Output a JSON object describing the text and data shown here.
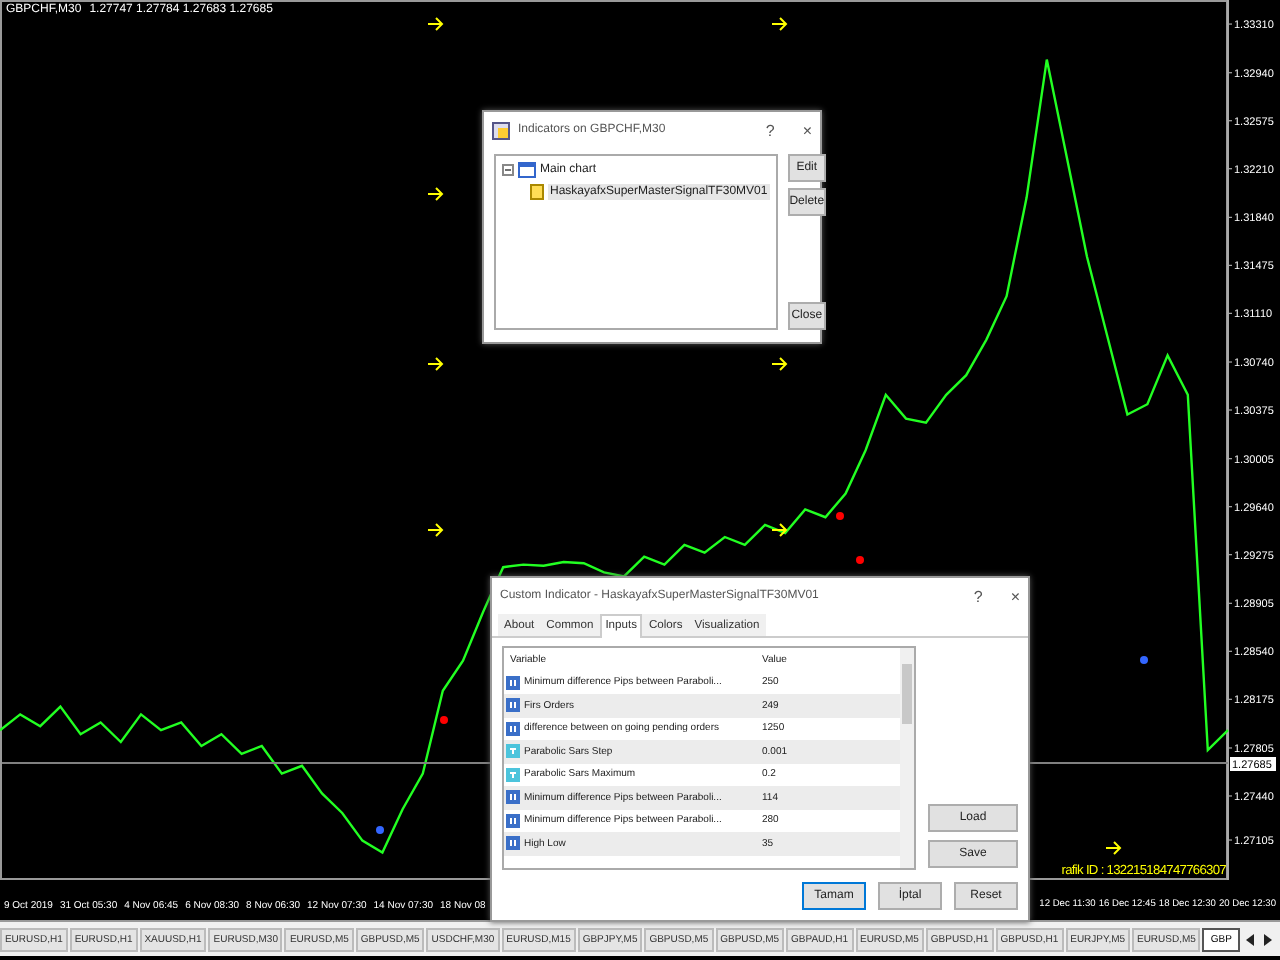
{
  "chart": {
    "chart_data": {
      "type": "line",
      "ylim": [
        1.26801,
        1.33493
      ],
      "yticks": [
        {
          "value": 1.3331,
          "label": "1.33310"
        },
        {
          "value": 1.3294,
          "label": "1.32940"
        },
        {
          "value": 1.32575,
          "label": "1.32575"
        },
        {
          "value": 1.3221,
          "label": "1.32210"
        },
        {
          "value": 1.3184,
          "label": "1.31840"
        },
        {
          "value": 1.31475,
          "label": "1.31475"
        },
        {
          "value": 1.3111,
          "label": "1.31110"
        },
        {
          "value": 1.3074,
          "label": "1.30740"
        },
        {
          "value": 1.30375,
          "label": "1.30375"
        },
        {
          "value": 1.30005,
          "label": "1.30005"
        },
        {
          "value": 1.2964,
          "label": "1.29640"
        },
        {
          "value": 1.29275,
          "label": "1.29275"
        },
        {
          "value": 1.28905,
          "label": "1.28905"
        },
        {
          "value": 1.2854,
          "label": "1.28540"
        },
        {
          "value": 1.28175,
          "label": "1.28175"
        },
        {
          "value": 1.27805,
          "label": "1.27805"
        },
        {
          "value": 1.2744,
          "label": "1.27440"
        },
        {
          "value": 1.27105,
          "label": "1.27105"
        }
      ],
      "series": [
        {
          "name": "GBPCHF,M30",
          "color": "#22ff22",
          "values": [
            1.2794,
            1.2806,
            1.2797,
            1.2812,
            1.2791,
            1.28,
            1.2785,
            1.2806,
            1.2794,
            1.28,
            1.2782,
            1.2791,
            1.2776,
            1.2782,
            1.2761,
            1.2767,
            1.2746,
            1.2731,
            1.271,
            1.2701,
            1.2734,
            1.2761,
            1.2824,
            1.2847,
            1.2884,
            1.2918,
            1.292,
            1.2919,
            1.2922,
            1.2921,
            1.2914,
            1.2911,
            1.2926,
            1.292,
            1.2935,
            1.2929,
            1.2941,
            1.2935,
            1.295,
            1.2944,
            1.2962,
            1.2956,
            1.2974,
            1.3007,
            1.3049,
            1.3031,
            1.3028,
            1.3049,
            1.3064,
            1.3091,
            1.3124,
            1.3199,
            1.3304,
            1.3229,
            1.3154,
            1.3094,
            1.3034,
            1.3042,
            1.3079,
            1.3049,
            1.2779,
            1.2794
          ]
        }
      ]
    },
    "current_price": "1.27685",
    "header_values": "1.27747 1.27784 1.27683 1.27685",
    "id_text": "rafik ID : 132215184747766307",
    "time_axis_left": [
      "9 Oct 2019",
      "31 Oct 05:30",
      "4 Nov 06:45",
      "6 Nov 08:30",
      "8 Nov 06:30",
      "12 Nov 07:30",
      "14 Nov 07:30",
      "18 Nov 08"
    ],
    "time_axis_right": [
      "12 Dec 11:30",
      "16 Dec 12:45",
      "18 Dec 12:30",
      "20 Dec 12:30"
    ]
  },
  "tabs": [
    {
      "label": "EURUSD,H1",
      "selected": false
    },
    {
      "label": "EURUSD,H1",
      "selected": false
    },
    {
      "label": "XAUUSD,H1",
      "selected": false
    },
    {
      "label": "EURUSD,M30",
      "selected": false
    },
    {
      "label": "EURUSD,M5",
      "selected": false
    },
    {
      "label": "GBPUSD,M5",
      "selected": false
    },
    {
      "label": "USDCHF,M30",
      "selected": false
    },
    {
      "label": "EURUSD,M15",
      "selected": false
    },
    {
      "label": "GBPJPY,M5",
      "selected": false
    },
    {
      "label": "GBPUSD,M5",
      "selected": false
    },
    {
      "label": "GBPUSD,M5",
      "selected": false
    },
    {
      "label": "GBPAUD,H1",
      "selected": false
    },
    {
      "label": "EURUSD,M5",
      "selected": false
    },
    {
      "label": "GBPUSD,H1",
      "selected": false
    },
    {
      "label": "GBPUSD,H1",
      "selected": false
    },
    {
      "label": "EURJPY,M5",
      "selected": false
    },
    {
      "label": "EURUSD,M5",
      "selected": false
    },
    {
      "label": "GBP",
      "selected": true
    }
  ],
  "indicators_dialog": {
    "title": "Indicators on GBPCHF,M30",
    "help": "?",
    "close": "×",
    "tree": [
      {
        "label": "Main chart",
        "expanded": true,
        "children": [
          {
            "label": "HaskayafxSuperMasterSignalTF30MV01"
          }
        ]
      }
    ],
    "buttons": [
      "Edit",
      "Delete"
    ],
    "close_button": "Close"
  },
  "custom_dialog": {
    "title": "Custom Indicator - HaskayafxSuperMasterSignalTF30MV01",
    "help": "?",
    "close": "×",
    "tabs": [
      {
        "label": "About",
        "selected": false
      },
      {
        "label": "Common",
        "selected": false
      },
      {
        "label": "Inputs",
        "selected": true
      },
      {
        "label": "Colors",
        "selected": false
      },
      {
        "label": "Visualization",
        "selected": false
      }
    ],
    "columns": [
      "Variable",
      "Value"
    ],
    "rows": [
      {
        "kind": "int",
        "variable": "Minimum difference Pips between Paraboli...",
        "value": "250"
      },
      {
        "kind": "int",
        "variable": "Firs Orders",
        "value": "249"
      },
      {
        "kind": "int",
        "variable": "difference between on going pending orders",
        "value": "1250"
      },
      {
        "kind": "double",
        "variable": "Parabolic Sars Step",
        "value": "0.001"
      },
      {
        "kind": "double",
        "variable": "Parabolic Sars Maximum",
        "value": "0.2"
      },
      {
        "kind": "int",
        "variable": "Minimum difference Pips between Paraboli...",
        "value": "114"
      },
      {
        "kind": "int",
        "variable": "Minimum difference Pips between Paraboli...",
        "value": "280"
      },
      {
        "kind": "int",
        "variable": "High Low",
        "value": "35"
      }
    ],
    "side_buttons": [
      "Load",
      "Save"
    ],
    "buttons": [
      "Tamam",
      "İptal",
      "Reset"
    ]
  }
}
